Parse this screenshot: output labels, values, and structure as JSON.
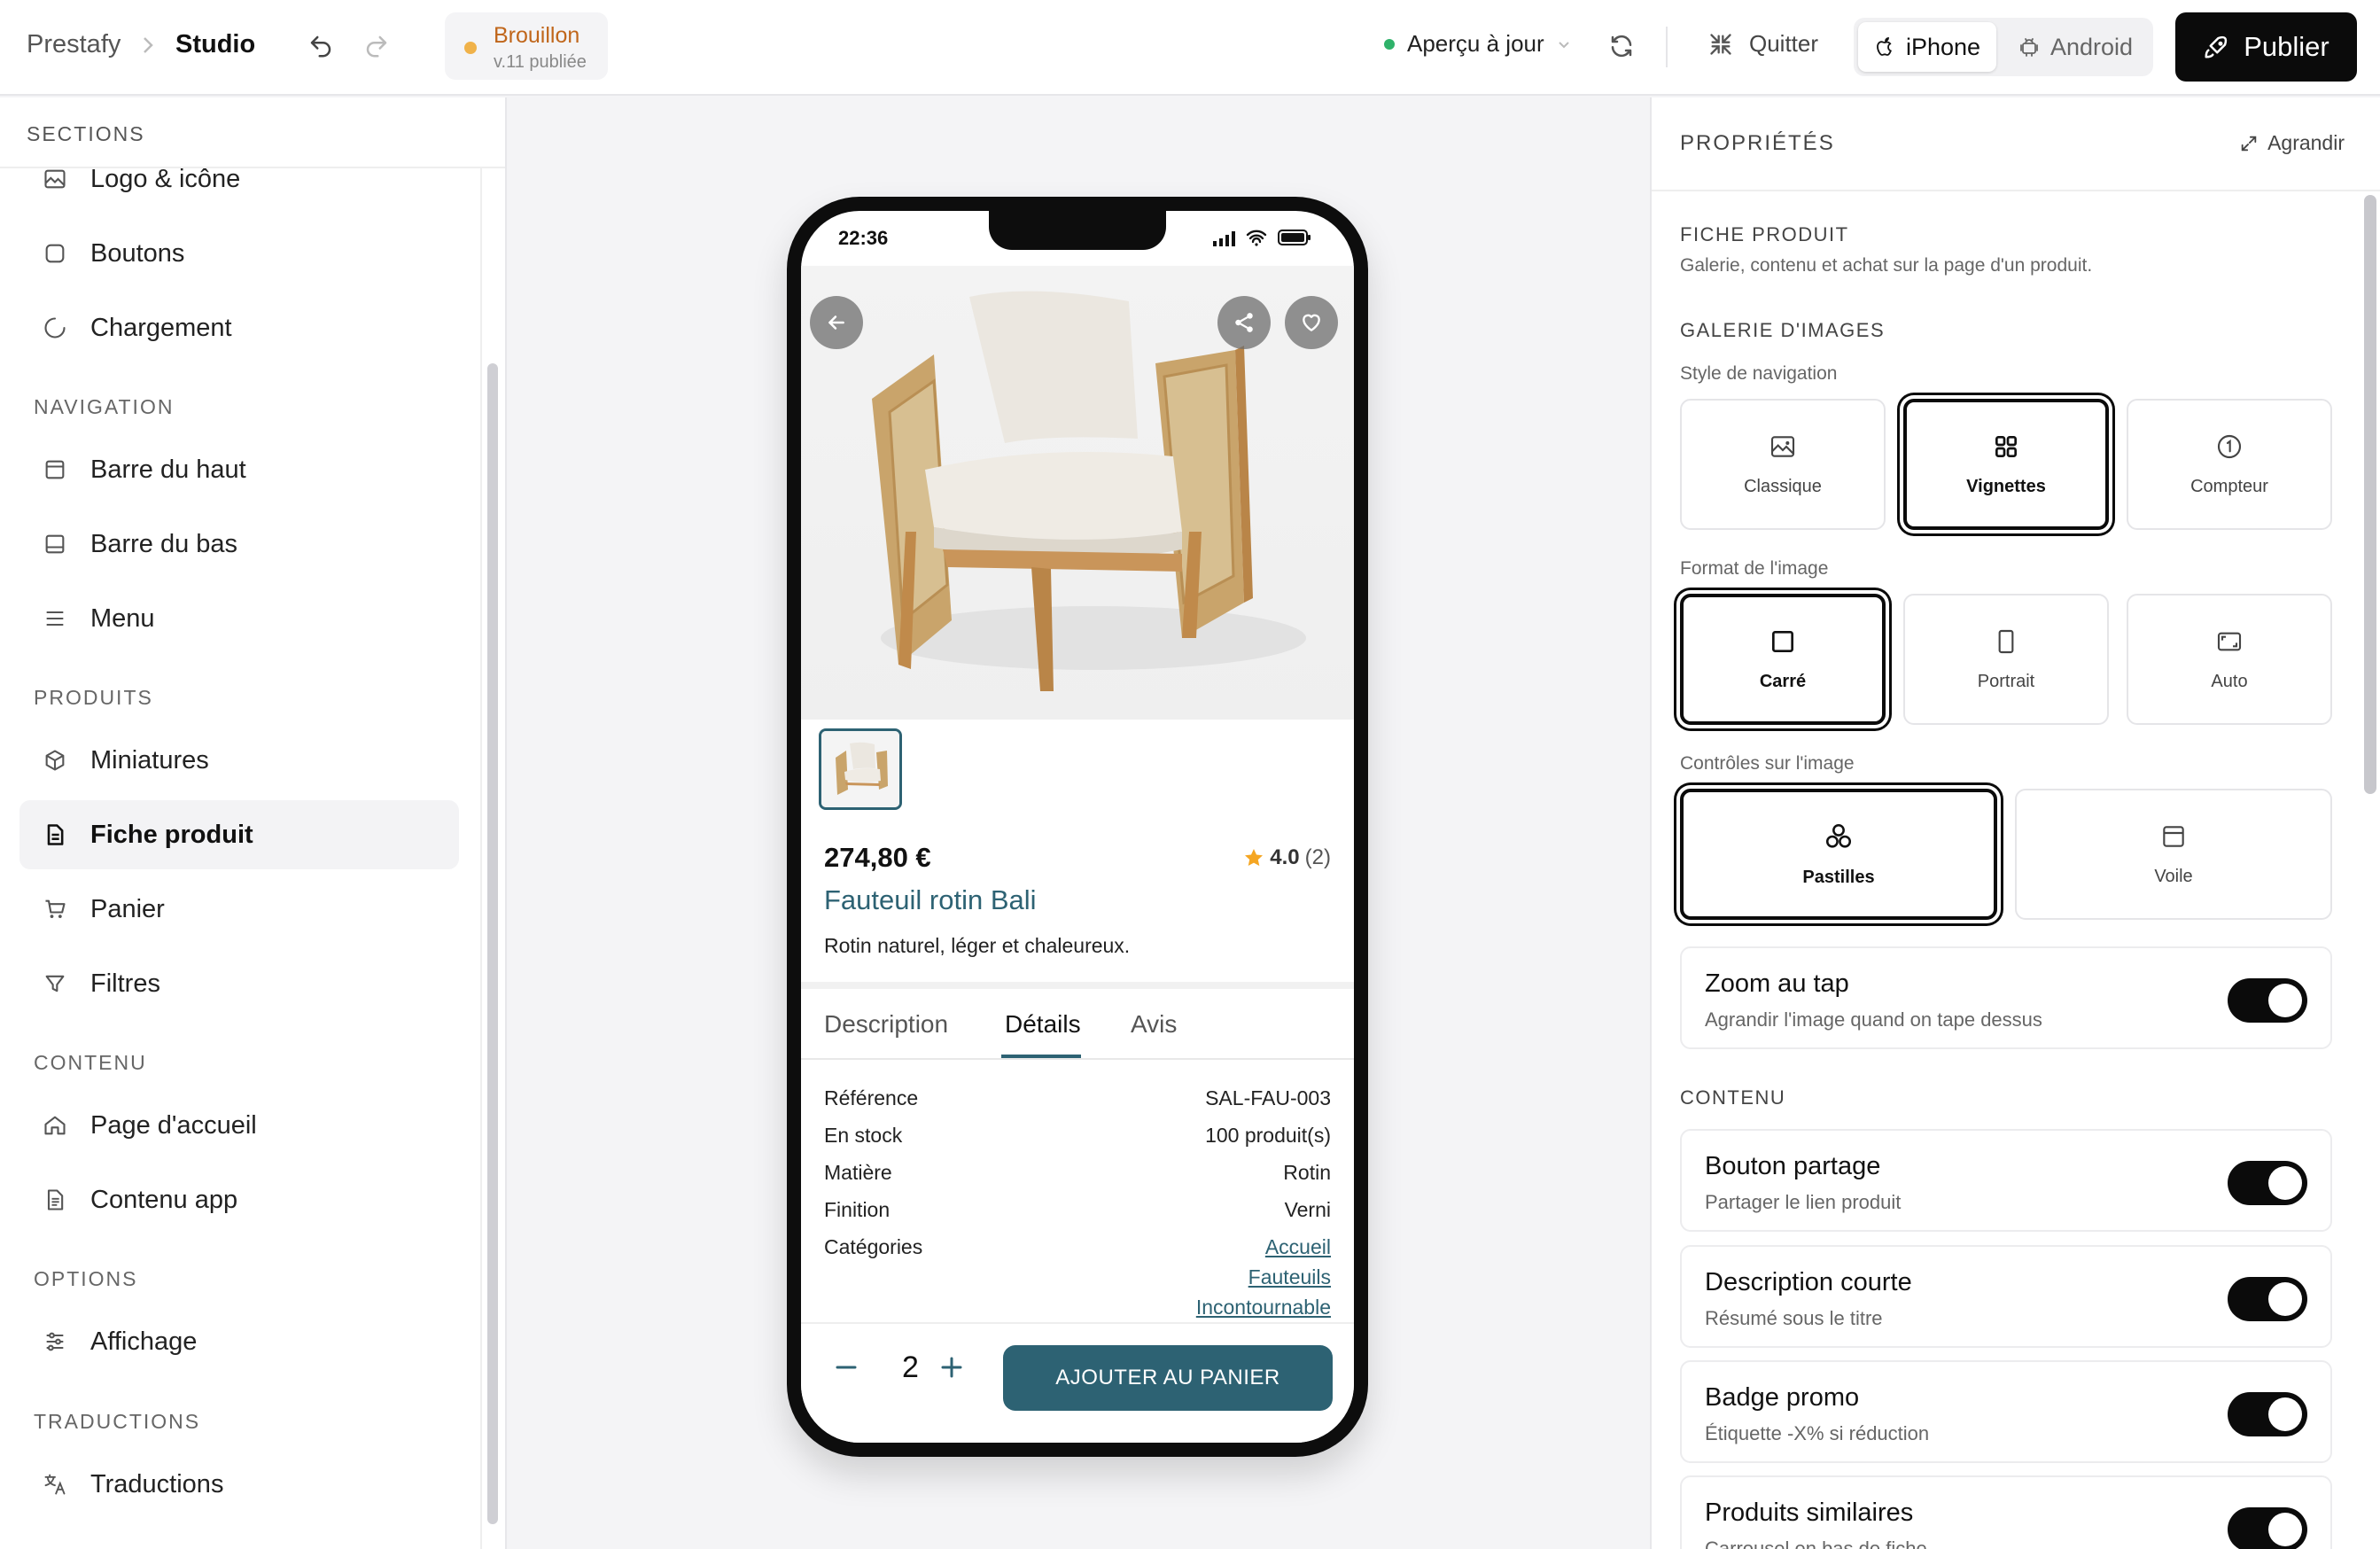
{
  "topbar": {
    "app": "Prestafy",
    "section": "Studio",
    "status_label": "Brouillon",
    "status_version": "v.11 publiée",
    "preview_label": "Aperçu à jour",
    "quit_label": "Quitter",
    "device_iphone": "iPhone",
    "device_android": "Android",
    "publish_label": "Publier",
    "colors": {
      "draft_dot": "#f0b24a",
      "draft_text": "#c0661b",
      "preview_dot": "#2fb26a",
      "publish_bg": "#0b0b0b"
    }
  },
  "sidebar": {
    "header": "SECTIONS",
    "items_top": [
      {
        "label": "Logo & icône",
        "icon": "image-icon"
      },
      {
        "label": "Boutons",
        "icon": "square-icon"
      },
      {
        "label": "Chargement",
        "icon": "loader-icon"
      }
    ],
    "groups": [
      {
        "title": "NAVIGATION",
        "items": [
          {
            "label": "Barre du haut",
            "icon": "topbar-icon"
          },
          {
            "label": "Barre du bas",
            "icon": "bottombar-icon"
          },
          {
            "label": "Menu",
            "icon": "menu-icon"
          }
        ]
      },
      {
        "title": "PRODUITS",
        "items": [
          {
            "label": "Miniatures",
            "icon": "box-icon"
          },
          {
            "label": "Fiche produit",
            "icon": "file-icon",
            "active": true
          },
          {
            "label": "Panier",
            "icon": "cart-icon"
          },
          {
            "label": "Filtres",
            "icon": "filter-icon"
          }
        ]
      },
      {
        "title": "CONTENU",
        "items": [
          {
            "label": "Page d'accueil",
            "icon": "home-icon"
          },
          {
            "label": "Contenu app",
            "icon": "document-icon"
          }
        ]
      },
      {
        "title": "OPTIONS",
        "items": [
          {
            "label": "Affichage",
            "icon": "sliders-icon"
          }
        ]
      },
      {
        "title": "TRADUCTIONS",
        "items": [
          {
            "label": "Traductions",
            "icon": "translate-icon"
          }
        ]
      }
    ]
  },
  "preview": {
    "time": "22:36",
    "price": "274,80 €",
    "rating": "4.0",
    "rating_count": "(2)",
    "name": "Fauteuil rotin Bali",
    "short_desc": "Rotin naturel, léger et chaleureux.",
    "tabs": [
      "Description",
      "Détails",
      "Avis"
    ],
    "active_tab": "Détails",
    "details": [
      {
        "label": "Référence",
        "value": "SAL-FAU-003"
      },
      {
        "label": "En stock",
        "value": "100 produit(s)"
      },
      {
        "label": "Matière",
        "value": "Rotin"
      },
      {
        "label": "Finition",
        "value": "Verni"
      }
    ],
    "categories_label": "Catégories",
    "categories": [
      "Accueil",
      "Fauteuils",
      "Incontournable"
    ],
    "quantity": "2",
    "add_to_cart": "AJOUTER AU PANIER",
    "colors": {
      "accent": "#2d6273",
      "star": "#f5a623"
    }
  },
  "panel": {
    "header": "PROPRIÉTÉS",
    "expand_label": "Agrandir",
    "section_title": "FICHE PRODUIT",
    "section_desc": "Galerie, contenu et achat sur la page d'un produit.",
    "gallery_title": "GALERIE D'IMAGES",
    "nav_style_label": "Style de navigation",
    "nav_style_options": [
      {
        "label": "Classique",
        "icon": "image-icon"
      },
      {
        "label": "Vignettes",
        "icon": "grid-icon",
        "selected": true
      },
      {
        "label": "Compteur",
        "icon": "counter-icon"
      }
    ],
    "image_format_label": "Format de l'image",
    "image_format_options": [
      {
        "label": "Carré",
        "icon": "square-icon",
        "selected": true
      },
      {
        "label": "Portrait",
        "icon": "portrait-icon"
      },
      {
        "label": "Auto",
        "icon": "auto-icon"
      }
    ],
    "image_controls_label": "Contrôles sur l'image",
    "image_controls_options": [
      {
        "label": "Pastilles",
        "icon": "dots-icon",
        "selected": true
      },
      {
        "label": "Voile",
        "icon": "veil-icon"
      }
    ],
    "zoom": {
      "title": "Zoom au tap",
      "desc": "Agrandir l'image quand on tape dessus",
      "on": true
    },
    "content_title": "CONTENU",
    "toggles": [
      {
        "title": "Bouton partage",
        "desc": "Partager le lien produit",
        "on": true
      },
      {
        "title": "Description courte",
        "desc": "Résumé sous le titre",
        "on": true
      },
      {
        "title": "Badge promo",
        "desc": "Étiquette -X% si réduction",
        "on": true
      },
      {
        "title": "Produits similaires",
        "desc": "Carrousel en bas de fiche",
        "on": true
      }
    ]
  }
}
